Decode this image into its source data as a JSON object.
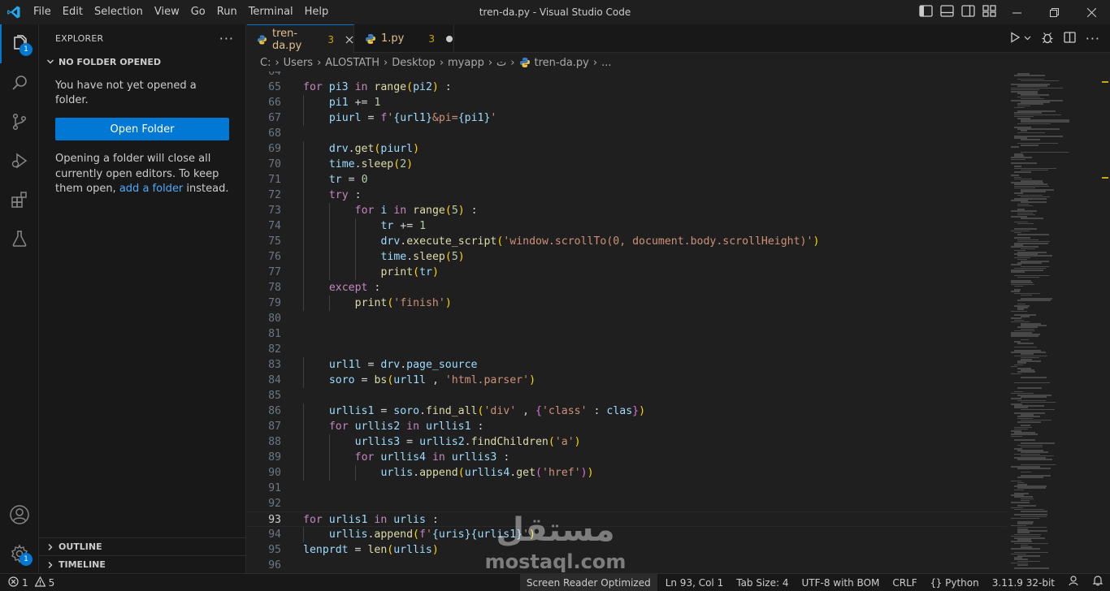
{
  "window": {
    "title": "tren-da.py - Visual Studio Code",
    "menu": [
      "File",
      "Edit",
      "Selection",
      "View",
      "Go",
      "Run",
      "Terminal",
      "Help"
    ]
  },
  "activity": {
    "explorer_badge": "1",
    "manage_badge": "1"
  },
  "sidebar": {
    "title": "EXPLORER",
    "section": "NO FOLDER OPENED",
    "message": "You have not yet opened a folder.",
    "open_folder_label": "Open Folder",
    "note_before": "Opening a folder will close all currently open editors. To keep them open, ",
    "note_link": "add a folder",
    "note_after": " instead.",
    "outline_label": "OUTLINE",
    "timeline_label": "TIMELINE"
  },
  "tabs": [
    {
      "name": "tren-da.py",
      "problems": "3",
      "active": true
    },
    {
      "name": "1.py",
      "problems": "3",
      "active": false
    }
  ],
  "breadcrumb": [
    "C:",
    "Users",
    "ALOSTATH",
    "Desktop",
    "myapp",
    "ت",
    "tren-da.py",
    "..."
  ],
  "code": {
    "first_line": 64,
    "current_line": 93,
    "lines": [
      "",
      "for pi3 in range(pi2) :",
      "    pi1 += 1",
      "    piurl = f'{url1}&pi={pi1}'",
      "",
      "    drv.get(piurl)",
      "    time.sleep(2)",
      "    tr = 0",
      "    try :",
      "        for i in range(5) :",
      "            tr += 1",
      "            drv.execute_script('window.scrollTo(0, document.body.scrollHeight)')",
      "            time.sleep(5)",
      "            print(tr)",
      "    except :",
      "        print('finish')",
      "",
      "",
      "",
      "    url1l = drv.page_source",
      "    soro = bs(url1l , 'html.parser')",
      "",
      "    urllis1 = soro.find_all('div' , {'class' : clas})",
      "    for urllis2 in urllis1 :",
      "        urllis3 = urllis2.findChildren('a')",
      "        for urllis4 in urllis3 :",
      "            urlis.append(urllis4.get('href'))",
      "",
      "",
      "for urlis1 in urlis :",
      "    urllis.append(f'{uris}{urlis1}')",
      "lenprdt = len(urllis)",
      ""
    ]
  },
  "status": {
    "errors": "1",
    "warnings": "5",
    "screen_reader": "Screen Reader Optimized",
    "position": "Ln 93, Col 1",
    "tab_size": "Tab Size: 4",
    "encoding": "UTF-8 with BOM",
    "eol": "CRLF",
    "language": "Python",
    "interpreter": "3.11.9 32-bit"
  },
  "watermark": {
    "arabic": "مستقل",
    "latin": "mostaql.com"
  },
  "colors": {
    "accent": "#0078d4",
    "keyword": "#c586c0",
    "function": "#dcdcaa",
    "variable": "#9cdcfe",
    "string": "#ce9178",
    "number": "#b5cea8",
    "warning": "#cca700"
  }
}
